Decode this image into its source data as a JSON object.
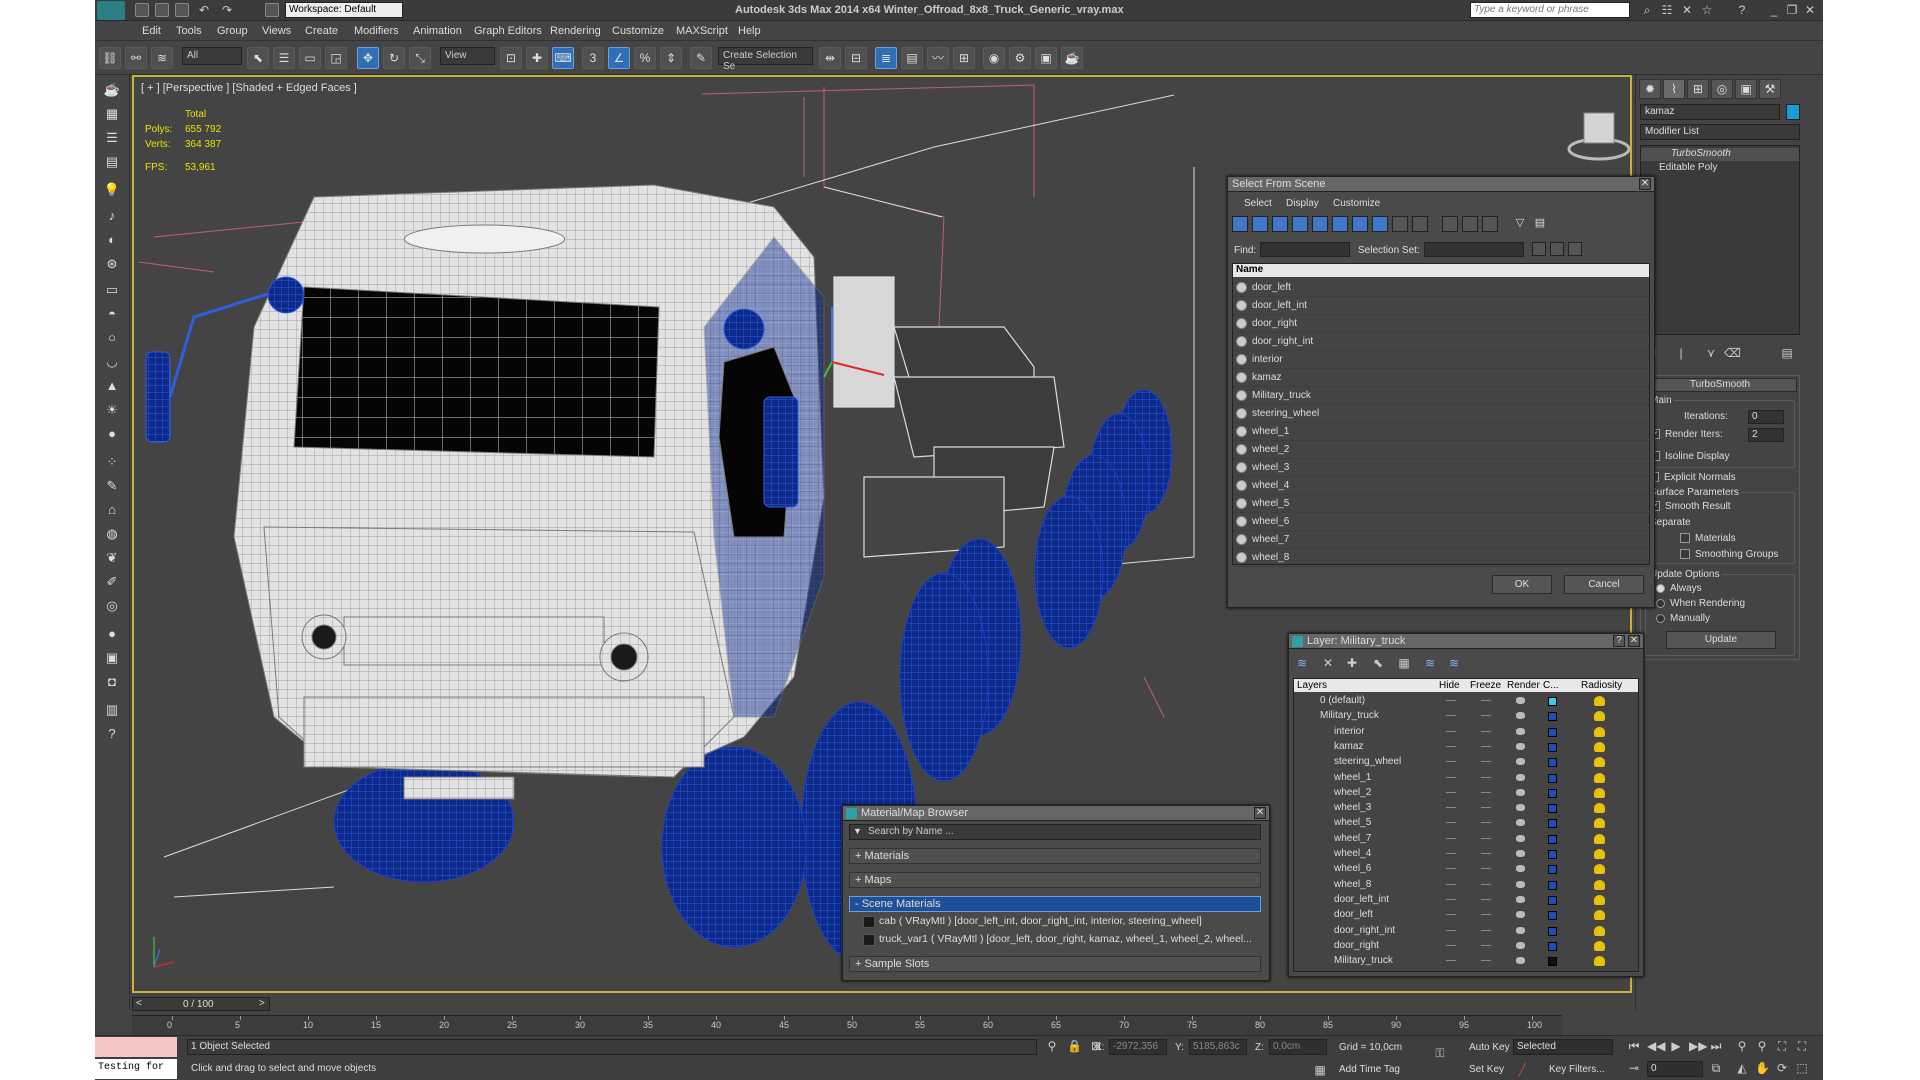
{
  "app": {
    "title": "Autodesk 3ds Max  2014 x64     Winter_Offroad_8x8_Truck_Generic_vray.max",
    "workspace": "Workspace: Default",
    "search_placeholder": "Type a keyword or phrase"
  },
  "menu": [
    "Edit",
    "Tools",
    "Group",
    "Views",
    "Create",
    "Modifiers",
    "Animation",
    "Graph Editors",
    "Rendering",
    "Customize",
    "MAXScript",
    "Help"
  ],
  "toolbar": {
    "filter": "All",
    "ref_coord": "View",
    "selection_set": "Create Selection Se",
    "snap_label": "3"
  },
  "viewport": {
    "label": "[ + ] [Perspective ] [Shaded + Edged Faces ]",
    "stats": {
      "total_label": "Total",
      "polys_label": "Polys:",
      "polys": "655 792",
      "verts_label": "Verts:",
      "verts": "364 387",
      "fps_label": "FPS:",
      "fps": "53,961"
    }
  },
  "select_from_scene": {
    "title": "Select From Scene",
    "menu": [
      "Select",
      "Display",
      "Customize"
    ],
    "find_label": "Find:",
    "selection_set_label": "Selection Set:",
    "column": "Name",
    "items": [
      "door_left",
      "door_left_int",
      "door_right",
      "door_right_int",
      "interior",
      "kamaz",
      "Military_truck",
      "steering_wheel",
      "wheel_1",
      "wheel_2",
      "wheel_3",
      "wheel_4",
      "wheel_5",
      "wheel_6",
      "wheel_7",
      "wheel_8"
    ],
    "ok": "OK",
    "cancel": "Cancel"
  },
  "layer_manager": {
    "title": "Layer: Military_truck",
    "columns": [
      "Layers",
      "Hide",
      "Freeze",
      "Render",
      "C...",
      "Radiosity"
    ],
    "rows": [
      {
        "name": "0 (default)",
        "indent": 0,
        "color": "#3cc8e6"
      },
      {
        "name": "Military_truck",
        "indent": 0,
        "color": "#1d4fb8"
      },
      {
        "name": "interior",
        "indent": 1,
        "color": "#1d4fb8"
      },
      {
        "name": "kamaz",
        "indent": 1,
        "color": "#1d4fb8"
      },
      {
        "name": "steering_wheel",
        "indent": 1,
        "color": "#1d4fb8"
      },
      {
        "name": "wheel_1",
        "indent": 1,
        "color": "#1d4fb8"
      },
      {
        "name": "wheel_2",
        "indent": 1,
        "color": "#1d4fb8"
      },
      {
        "name": "wheel_3",
        "indent": 1,
        "color": "#1d4fb8"
      },
      {
        "name": "wheel_5",
        "indent": 1,
        "color": "#1d4fb8"
      },
      {
        "name": "wheel_7",
        "indent": 1,
        "color": "#1d4fb8"
      },
      {
        "name": "wheel_4",
        "indent": 1,
        "color": "#1d4fb8"
      },
      {
        "name": "wheel_6",
        "indent": 1,
        "color": "#1d4fb8"
      },
      {
        "name": "wheel_8",
        "indent": 1,
        "color": "#1d4fb8"
      },
      {
        "name": "door_left_int",
        "indent": 1,
        "color": "#1d4fb8"
      },
      {
        "name": "door_left",
        "indent": 1,
        "color": "#1d4fb8"
      },
      {
        "name": "door_right_int",
        "indent": 1,
        "color": "#1d4fb8"
      },
      {
        "name": "door_right",
        "indent": 1,
        "color": "#1d4fb8"
      },
      {
        "name": "Military_truck",
        "indent": 1,
        "color": "#111111"
      }
    ]
  },
  "material_browser": {
    "title": "Material/Map Browser",
    "search_placeholder": "Search by Name ...",
    "sections": [
      "+ Materials",
      "+ Maps",
      "- Scene Materials",
      "+ Sample Slots"
    ],
    "scene_materials": [
      "cab  ( VRayMtl )  [door_left_int, door_right_int, interior, steering_wheel]",
      "truck_var1  ( VRayMtl )  [door_left, door_right, kamaz, wheel_1, wheel_2, wheel..."
    ]
  },
  "command_panel": {
    "object_name": "kamaz",
    "modifier_list": "Modifier List",
    "stack": [
      "TurboSmooth",
      "Editable Poly"
    ],
    "rollout_title": "TurboSmooth",
    "main_label": "Main",
    "iterations_label": "Iterations:",
    "iterations": "0",
    "render_iters_label": "Render Iters:",
    "render_iters": "2",
    "isoline": "Isoline Display",
    "explicit": "Explicit Normals",
    "surface_params": "Surface Parameters",
    "smooth_result": "Smooth Result",
    "separate": "Separate",
    "materials": "Materials",
    "smoothing_groups": "Smoothing Groups",
    "update_options": "Update Options",
    "always": "Always",
    "when_rendering": "When Rendering",
    "manually": "Manually",
    "update": "Update"
  },
  "timeline": {
    "frame": "0 / 100",
    "ticks": [
      "0",
      "5",
      "10",
      "15",
      "20",
      "25",
      "30",
      "35",
      "40",
      "45",
      "50",
      "55",
      "60",
      "65",
      "70",
      "75",
      "80",
      "85",
      "90",
      "95",
      "100"
    ]
  },
  "status": {
    "script_listener": "Testing for",
    "selected": "1 Object Selected",
    "prompt": "Click and drag to select and move objects",
    "x_label": "X:",
    "x": "-2972,356",
    "y_label": "Y:",
    "y": "5185,863c",
    "z_label": "Z:",
    "z": "0,0cm",
    "grid": "Grid = 10,0cm",
    "add_time_tag": "Add Time Tag",
    "auto_key": "Auto Key",
    "auto_key_mode": "Selected",
    "set_key": "Set Key",
    "key_filters": "Key Filters...",
    "current_frame": "0"
  }
}
